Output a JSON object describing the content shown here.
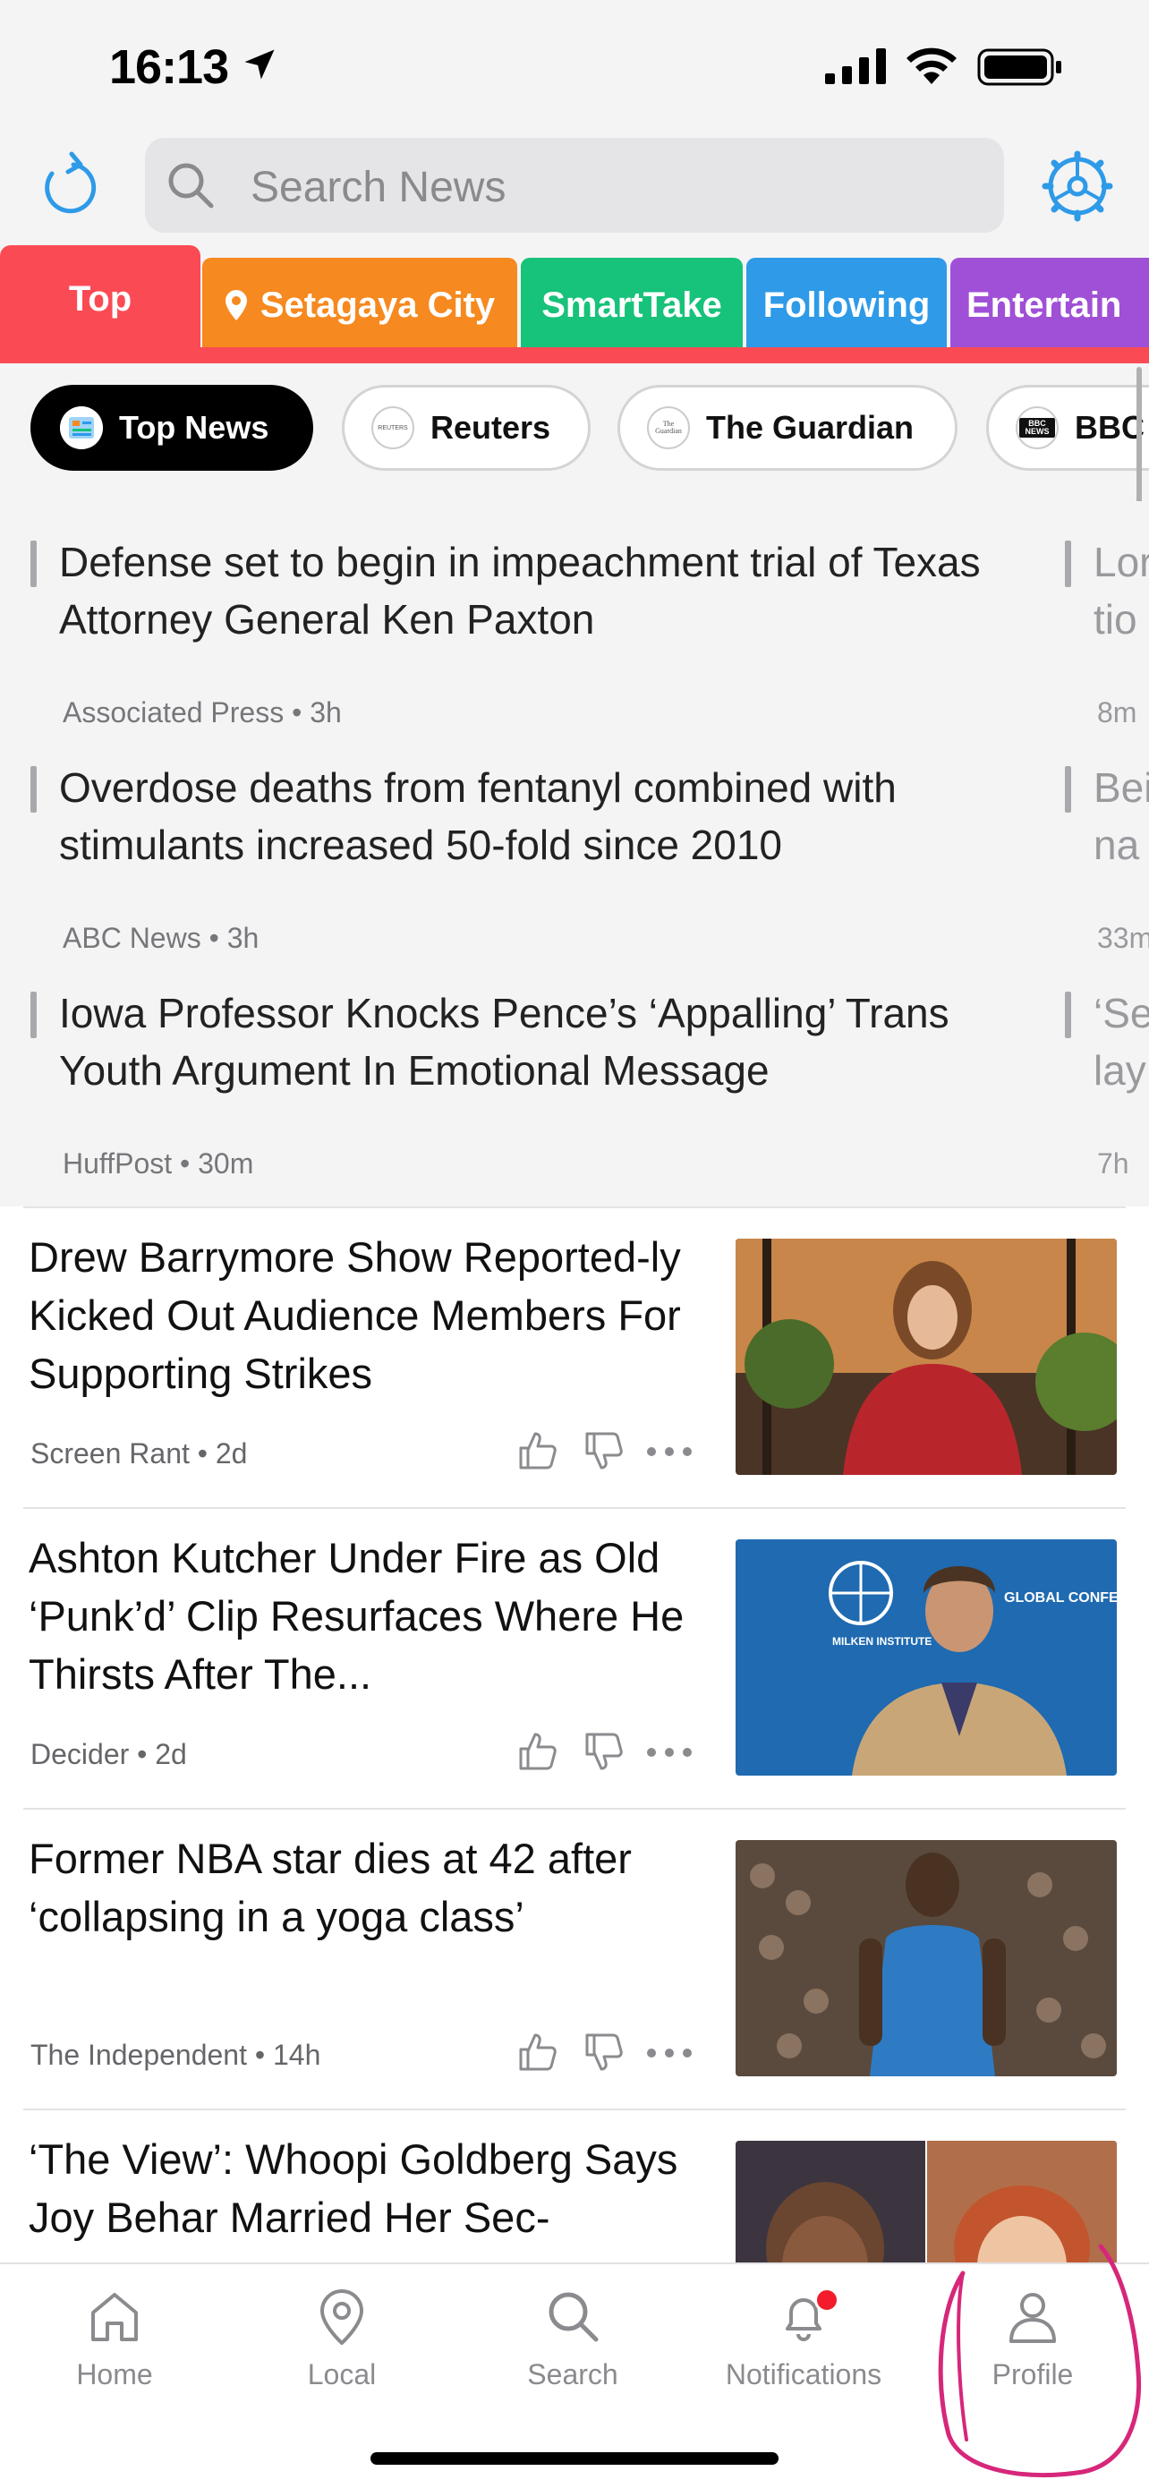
{
  "status_bar": {
    "time": "16:13"
  },
  "search": {
    "placeholder": "Search News"
  },
  "tabs": [
    {
      "label": "Top",
      "color": "#fa4b55"
    },
    {
      "label": "Setagaya City",
      "color": "#f6891f"
    },
    {
      "label": "SmartTake",
      "color": "#17c27a"
    },
    {
      "label": "Following",
      "color": "#2e9ae8"
    },
    {
      "label": "Entertain",
      "color": "#a050d6"
    }
  ],
  "sources": [
    {
      "label": "Top News",
      "active": true
    },
    {
      "label": "Reuters",
      "active": false
    },
    {
      "label": "The Guardian",
      "active": false
    },
    {
      "label": "BBC",
      "active": false
    }
  ],
  "source_logos": [
    "REUTERS",
    "The Guardian",
    "BBC NEWS"
  ],
  "top_stories": [
    {
      "title": "Defense set to begin in impeachment trial of Texas Attorney General Ken Paxton",
      "source": "Associated Press",
      "age": "3h"
    },
    {
      "title": "Overdose deaths from fentanyl combined with stimulants increased 50-fold since 2010",
      "source": "ABC News",
      "age": "3h"
    },
    {
      "title": "Iowa Professor Knocks Pence’s ‘Appalling’ Trans Youth Argument In Emotional Message",
      "source": "HuffPost",
      "age": "30m"
    }
  ],
  "top_stories_peek": [
    {
      "line1": "Lor",
      "line2": "tio",
      "meta": "8m"
    },
    {
      "line1": "Bei",
      "line2": "na",
      "meta": "33m"
    },
    {
      "line1": "‘Se",
      "line2": "lay",
      "meta": "7h"
    }
  ],
  "feed": [
    {
      "title": "Drew Barrymore Show Reported-ly Kicked Out Audience Members For Supporting Strikes",
      "source": "Screen Rant",
      "age": "2d"
    },
    {
      "title": "Ashton Kutcher Under Fire as Old ‘Punk’d’ Clip Resurfaces Where He Thirsts After The...",
      "source": "Decider",
      "age": "2d"
    },
    {
      "title": "Former NBA star dies at 42 after ‘collapsing in a yoga class’",
      "source": "The Independent",
      "age": "14h"
    },
    {
      "title": "‘The View’: Whoopi Goldberg Says Joy Behar Married Her Sec-",
      "source": "",
      "age": ""
    }
  ],
  "image_texts": {
    "milken": "MILKEN INSTITUTE",
    "global": "GLOBAL CONFERENCE"
  },
  "meta_separator": "•",
  "bottom_nav": [
    {
      "label": "Home",
      "icon": "home-icon"
    },
    {
      "label": "Local",
      "icon": "location-pin-icon"
    },
    {
      "label": "Search",
      "icon": "search-icon"
    },
    {
      "label": "Notifications",
      "icon": "bell-icon"
    },
    {
      "label": "Profile",
      "icon": "profile-icon"
    }
  ],
  "colors": {
    "accent": "#fa4b55",
    "annotation": "#d6277a"
  }
}
